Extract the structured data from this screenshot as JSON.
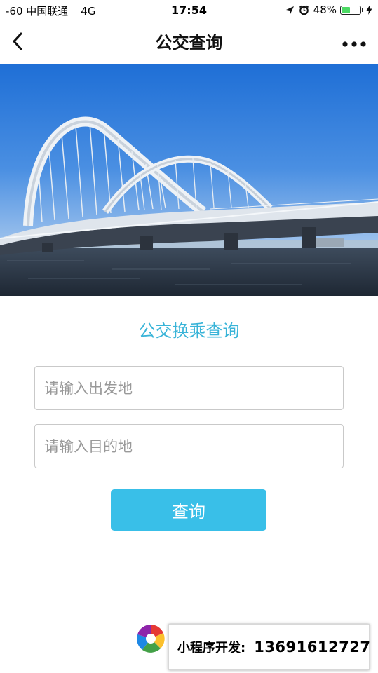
{
  "status_bar": {
    "carrier": "-60 中国联通",
    "network": "4G",
    "time": "17:54",
    "battery_percent_label": "48%",
    "battery_level": 0.48,
    "icons": [
      "location-arrow-icon",
      "alarm-clock-icon",
      "battery-icon",
      "charging-bolt-icon"
    ],
    "battery_color": "#4cd964"
  },
  "nav": {
    "title": "公交查询",
    "back_icon": "chevron-left-icon",
    "more_icon": "more-dots-icon"
  },
  "hero": {
    "image": "bridge-photo"
  },
  "form": {
    "title": "公交换乘查询",
    "title_color": "#39b4d8",
    "origin": {
      "value": "",
      "placeholder": "请输入出发地"
    },
    "destination": {
      "value": "",
      "placeholder": "请输入目的地"
    },
    "submit_label": "查询",
    "submit_color": "#39bfe8"
  },
  "promo": {
    "logo": "developer-logo",
    "label": "小程序开发:",
    "phone": "13691612727"
  }
}
